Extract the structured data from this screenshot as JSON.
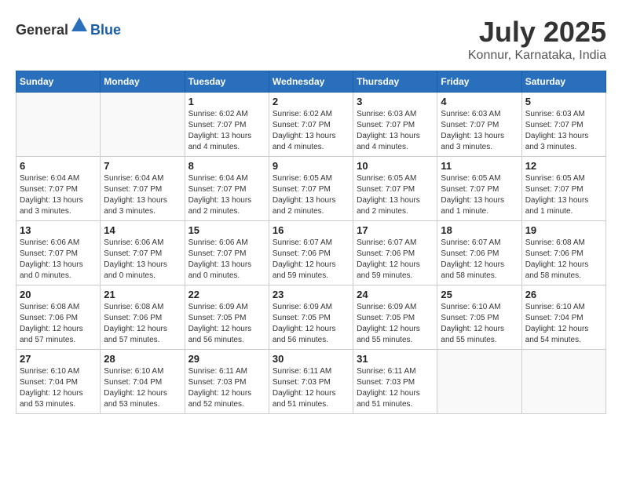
{
  "header": {
    "logo_general": "General",
    "logo_blue": "Blue",
    "month_title": "July 2025",
    "location": "Konnur, Karnataka, India"
  },
  "days_of_week": [
    "Sunday",
    "Monday",
    "Tuesday",
    "Wednesday",
    "Thursday",
    "Friday",
    "Saturday"
  ],
  "weeks": [
    [
      {
        "day": "",
        "info": ""
      },
      {
        "day": "",
        "info": ""
      },
      {
        "day": "1",
        "info": "Sunrise: 6:02 AM\nSunset: 7:07 PM\nDaylight: 13 hours and 4 minutes."
      },
      {
        "day": "2",
        "info": "Sunrise: 6:02 AM\nSunset: 7:07 PM\nDaylight: 13 hours and 4 minutes."
      },
      {
        "day": "3",
        "info": "Sunrise: 6:03 AM\nSunset: 7:07 PM\nDaylight: 13 hours and 4 minutes."
      },
      {
        "day": "4",
        "info": "Sunrise: 6:03 AM\nSunset: 7:07 PM\nDaylight: 13 hours and 3 minutes."
      },
      {
        "day": "5",
        "info": "Sunrise: 6:03 AM\nSunset: 7:07 PM\nDaylight: 13 hours and 3 minutes."
      }
    ],
    [
      {
        "day": "6",
        "info": "Sunrise: 6:04 AM\nSunset: 7:07 PM\nDaylight: 13 hours and 3 minutes."
      },
      {
        "day": "7",
        "info": "Sunrise: 6:04 AM\nSunset: 7:07 PM\nDaylight: 13 hours and 3 minutes."
      },
      {
        "day": "8",
        "info": "Sunrise: 6:04 AM\nSunset: 7:07 PM\nDaylight: 13 hours and 2 minutes."
      },
      {
        "day": "9",
        "info": "Sunrise: 6:05 AM\nSunset: 7:07 PM\nDaylight: 13 hours and 2 minutes."
      },
      {
        "day": "10",
        "info": "Sunrise: 6:05 AM\nSunset: 7:07 PM\nDaylight: 13 hours and 2 minutes."
      },
      {
        "day": "11",
        "info": "Sunrise: 6:05 AM\nSunset: 7:07 PM\nDaylight: 13 hours and 1 minute."
      },
      {
        "day": "12",
        "info": "Sunrise: 6:05 AM\nSunset: 7:07 PM\nDaylight: 13 hours and 1 minute."
      }
    ],
    [
      {
        "day": "13",
        "info": "Sunrise: 6:06 AM\nSunset: 7:07 PM\nDaylight: 13 hours and 0 minutes."
      },
      {
        "day": "14",
        "info": "Sunrise: 6:06 AM\nSunset: 7:07 PM\nDaylight: 13 hours and 0 minutes."
      },
      {
        "day": "15",
        "info": "Sunrise: 6:06 AM\nSunset: 7:07 PM\nDaylight: 13 hours and 0 minutes."
      },
      {
        "day": "16",
        "info": "Sunrise: 6:07 AM\nSunset: 7:06 PM\nDaylight: 12 hours and 59 minutes."
      },
      {
        "day": "17",
        "info": "Sunrise: 6:07 AM\nSunset: 7:06 PM\nDaylight: 12 hours and 59 minutes."
      },
      {
        "day": "18",
        "info": "Sunrise: 6:07 AM\nSunset: 7:06 PM\nDaylight: 12 hours and 58 minutes."
      },
      {
        "day": "19",
        "info": "Sunrise: 6:08 AM\nSunset: 7:06 PM\nDaylight: 12 hours and 58 minutes."
      }
    ],
    [
      {
        "day": "20",
        "info": "Sunrise: 6:08 AM\nSunset: 7:06 PM\nDaylight: 12 hours and 57 minutes."
      },
      {
        "day": "21",
        "info": "Sunrise: 6:08 AM\nSunset: 7:06 PM\nDaylight: 12 hours and 57 minutes."
      },
      {
        "day": "22",
        "info": "Sunrise: 6:09 AM\nSunset: 7:05 PM\nDaylight: 12 hours and 56 minutes."
      },
      {
        "day": "23",
        "info": "Sunrise: 6:09 AM\nSunset: 7:05 PM\nDaylight: 12 hours and 56 minutes."
      },
      {
        "day": "24",
        "info": "Sunrise: 6:09 AM\nSunset: 7:05 PM\nDaylight: 12 hours and 55 minutes."
      },
      {
        "day": "25",
        "info": "Sunrise: 6:10 AM\nSunset: 7:05 PM\nDaylight: 12 hours and 55 minutes."
      },
      {
        "day": "26",
        "info": "Sunrise: 6:10 AM\nSunset: 7:04 PM\nDaylight: 12 hours and 54 minutes."
      }
    ],
    [
      {
        "day": "27",
        "info": "Sunrise: 6:10 AM\nSunset: 7:04 PM\nDaylight: 12 hours and 53 minutes."
      },
      {
        "day": "28",
        "info": "Sunrise: 6:10 AM\nSunset: 7:04 PM\nDaylight: 12 hours and 53 minutes."
      },
      {
        "day": "29",
        "info": "Sunrise: 6:11 AM\nSunset: 7:03 PM\nDaylight: 12 hours and 52 minutes."
      },
      {
        "day": "30",
        "info": "Sunrise: 6:11 AM\nSunset: 7:03 PM\nDaylight: 12 hours and 51 minutes."
      },
      {
        "day": "31",
        "info": "Sunrise: 6:11 AM\nSunset: 7:03 PM\nDaylight: 12 hours and 51 minutes."
      },
      {
        "day": "",
        "info": ""
      },
      {
        "day": "",
        "info": ""
      }
    ]
  ]
}
